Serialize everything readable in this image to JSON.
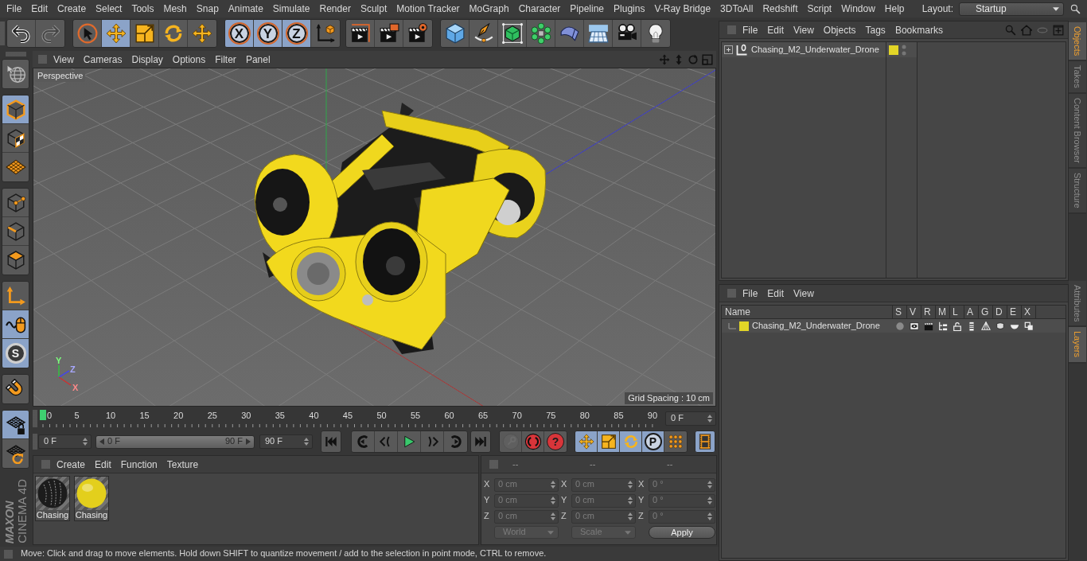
{
  "menu_bar": {
    "items": [
      "File",
      "Edit",
      "Create",
      "Select",
      "Tools",
      "Mesh",
      "Snap",
      "Animate",
      "Simulate",
      "Render",
      "Sculpt",
      "Motion Tracker",
      "MoGraph",
      "Character",
      "Pipeline",
      "Plugins",
      "V-Ray Bridge",
      "3DToAll",
      "Redshift",
      "Script",
      "Window",
      "Help"
    ],
    "layout_label": "Layout:",
    "layout_value": "Startup"
  },
  "toolbar": {
    "history": [
      {
        "disabled": false
      },
      {
        "disabled": true
      }
    ],
    "tools": [
      {
        "selected": false
      },
      {
        "selected": true
      },
      {
        "selected": false
      },
      {
        "selected": false
      },
      {
        "selected": false
      }
    ],
    "axes": [
      {
        "label": "X",
        "selected": true
      },
      {
        "label": "Y",
        "selected": true
      },
      {
        "label": "Z",
        "selected": true
      }
    ]
  },
  "mode_toolbar": [
    {
      "selected": false
    },
    {
      "selected": true
    },
    {
      "selected": false
    },
    {
      "selected": false
    },
    {
      "selected": false
    },
    {
      "selected": false
    },
    {
      "selected": false
    },
    {
      "selected": false
    },
    {
      "selected": true
    },
    {
      "label": "S",
      "selected": true
    },
    {
      "selected": false
    },
    {
      "selected": true
    },
    {
      "selected": false
    }
  ],
  "logo": {
    "brand": "MAXON",
    "product": "CINEMA 4D"
  },
  "viewport": {
    "menu": [
      "View",
      "Cameras",
      "Display",
      "Options",
      "Filter",
      "Panel"
    ],
    "camera": "Perspective",
    "grid_spacing": "Grid Spacing : 10 cm",
    "gizmo_labels": [
      "Y",
      "Z",
      "X"
    ]
  },
  "timeline": {
    "ticks": [
      "0",
      "5",
      "10",
      "15",
      "20",
      "25",
      "30",
      "35",
      "40",
      "45",
      "50",
      "55",
      "60",
      "65",
      "70",
      "75",
      "80",
      "85",
      "90"
    ],
    "current_frame": "0 F"
  },
  "transport": {
    "start_frame": "0 F",
    "range_start": "0 F",
    "range_end": "90 F",
    "end_frame": "90 F",
    "record_buttons": [
      {
        "disabled": true
      },
      {
        "disabled": false
      },
      {
        "label": "?",
        "disabled": false
      }
    ],
    "key_tracks": [
      {
        "selected": true
      },
      {
        "selected": true
      },
      {
        "selected": true
      },
      {
        "label": "P",
        "selected": true
      },
      {
        "selected": false
      }
    ],
    "timeline_toggle": {
      "selected": true
    }
  },
  "material_manager": {
    "menu": [
      "Create",
      "Edit",
      "Function",
      "Texture"
    ],
    "materials": [
      {
        "name": "Chasing",
        "color": "#1c1c1c"
      },
      {
        "name": "Chasing",
        "color": "#e3cf1c"
      }
    ]
  },
  "coordinates": {
    "headers": [
      "--",
      "--",
      "--"
    ],
    "rows": [
      {
        "labels": [
          "X",
          "X",
          "X"
        ],
        "values": [
          "0 cm",
          "0 cm",
          "0 °"
        ]
      },
      {
        "labels": [
          "Y",
          "Y",
          "Y"
        ],
        "values": [
          "0 cm",
          "0 cm",
          "0 °"
        ]
      },
      {
        "labels": [
          "Z",
          "Z",
          "Z"
        ],
        "values": [
          "0 cm",
          "0 cm",
          "0 °"
        ]
      }
    ],
    "dropdowns": [
      {
        "value": "World",
        "disabled": true
      },
      {
        "value": "Scale",
        "disabled": true
      }
    ],
    "apply": "Apply"
  },
  "status_bar": "Move: Click and drag to move elements. Hold down SHIFT to quantize movement / add to the selection in point mode, CTRL to remove.",
  "object_manager": {
    "menu": [
      "File",
      "Edit",
      "View",
      "Objects",
      "Tags",
      "Bookmarks"
    ],
    "objects": [
      {
        "name": "Chasing_M2_Underwater_Drone",
        "expanded": false,
        "color": "#e2d527"
      }
    ]
  },
  "layer_manager": {
    "menu": [
      "File",
      "Edit",
      "View"
    ],
    "columns": [
      "Name",
      "S",
      "V",
      "R",
      "M",
      "L",
      "A",
      "G",
      "D",
      "E",
      "X"
    ],
    "layers": [
      {
        "name": "Chasing_M2_Underwater_Drone",
        "color": "#e2d527"
      }
    ]
  },
  "side_tabs": {
    "upper": [
      {
        "label": "Objects",
        "selected": true
      },
      {
        "label": "Takes",
        "selected": false
      },
      {
        "label": "Content Browser",
        "selected": false
      },
      {
        "label": "Structure",
        "selected": false
      }
    ],
    "lower": [
      {
        "label": "Attributes",
        "selected": false
      },
      {
        "label": "Layers",
        "selected": true
      }
    ]
  }
}
